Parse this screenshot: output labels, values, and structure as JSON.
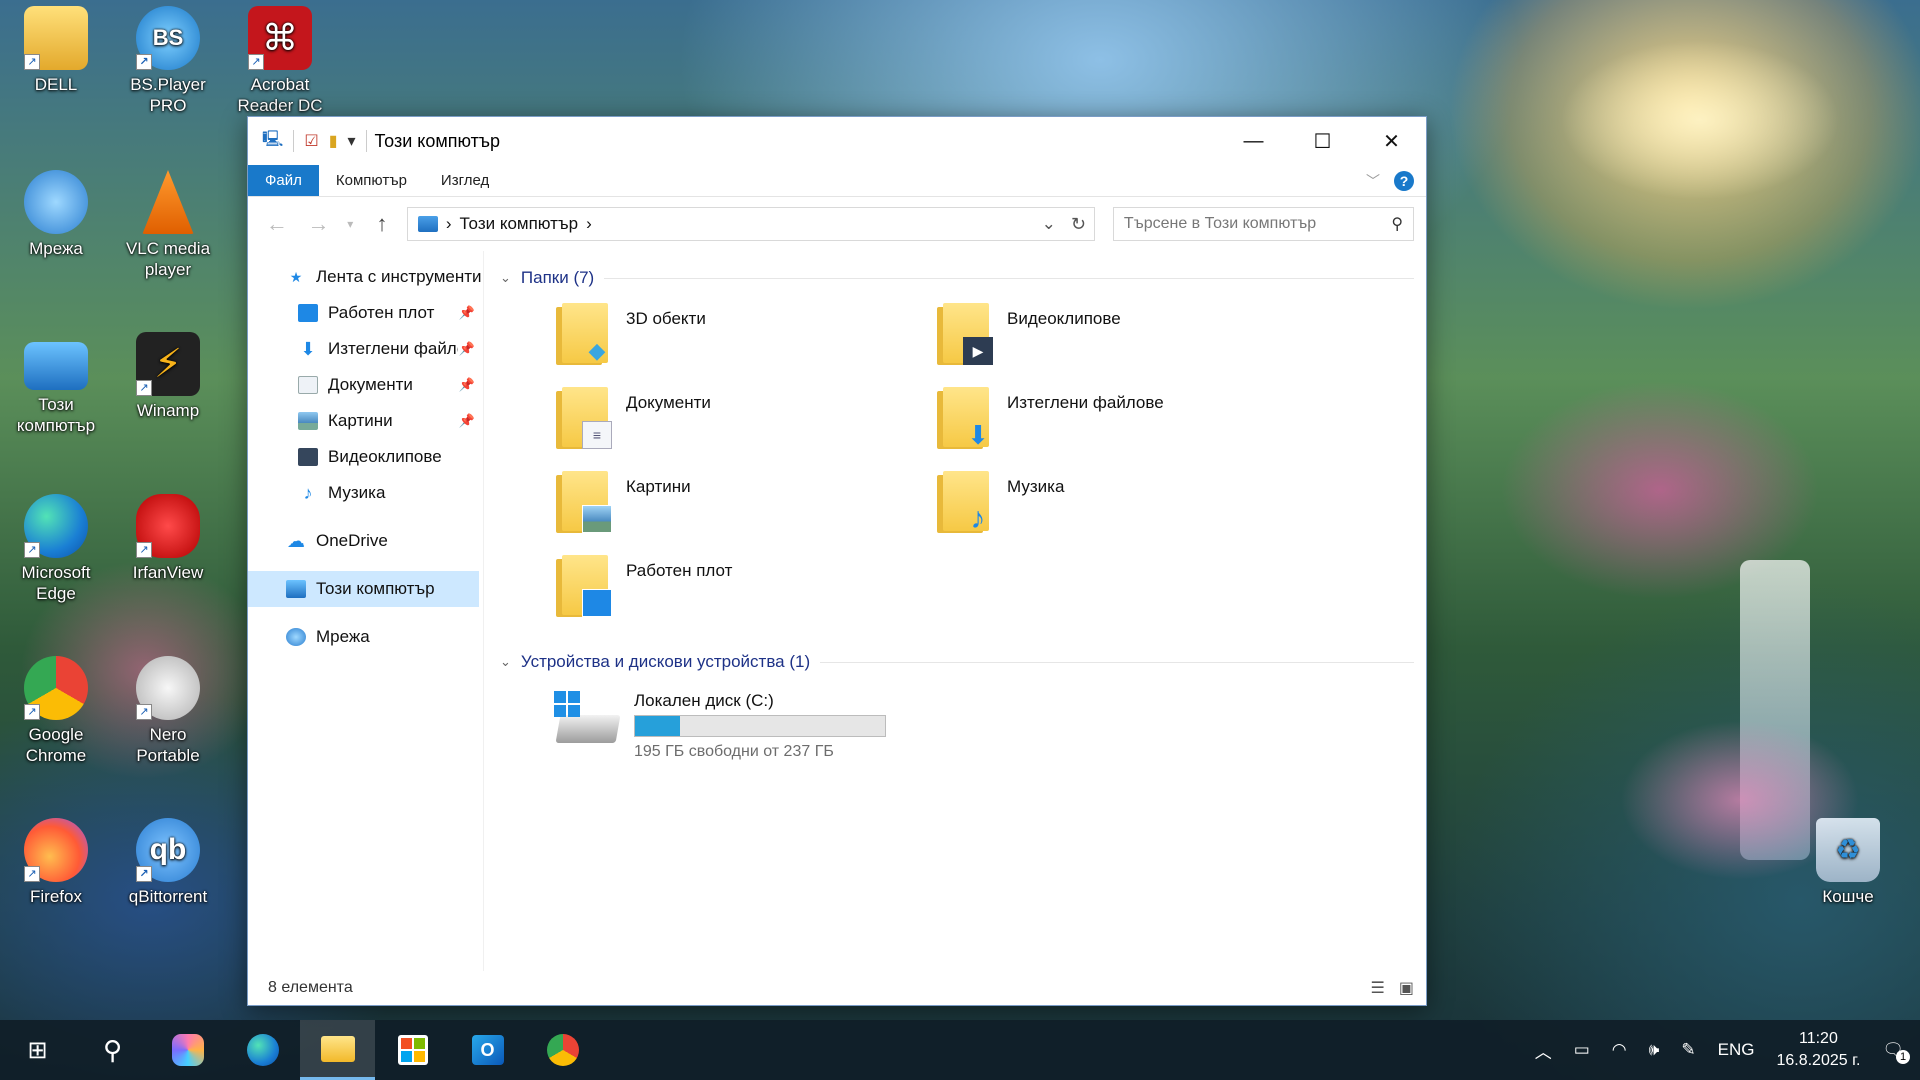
{
  "desktop": {
    "icons": [
      {
        "label": "DELL"
      },
      {
        "label": "BS.Player PRO"
      },
      {
        "label": "Acrobat Reader DC"
      },
      {
        "label": "Мрежа"
      },
      {
        "label": "VLC media player"
      },
      {
        "label": "Този компютър"
      },
      {
        "label": "Winamp"
      },
      {
        "label": "Microsoft Edge"
      },
      {
        "label": "IrfanView"
      },
      {
        "label": "Google Chrome"
      },
      {
        "label": "Nero Portable"
      },
      {
        "label": "Firefox"
      },
      {
        "label": "qBittorrent"
      },
      {
        "label": "Кошче"
      }
    ]
  },
  "window": {
    "title": "Този компютър",
    "ribbon": {
      "tabs": [
        "Файл",
        "Компютър",
        "Изглед"
      ],
      "help": "?"
    },
    "address": {
      "crumb": "Този компютър"
    },
    "search": {
      "placeholder": "Търсене в Този компютър"
    },
    "nav": {
      "quick_access": "Лента с инструменти",
      "items": [
        {
          "label": "Работен плот",
          "pinned": true
        },
        {
          "label": "Изтеглени файлове",
          "pinned": true
        },
        {
          "label": "Документи",
          "pinned": true
        },
        {
          "label": "Картини",
          "pinned": true
        },
        {
          "label": "Видеоклипове",
          "pinned": false
        },
        {
          "label": "Музика",
          "pinned": false
        }
      ],
      "onedrive": "OneDrive",
      "this_pc": "Този компютър",
      "network": "Мрежа"
    },
    "folders_header": "Папки (7)",
    "folders": [
      {
        "name": "3D обекти",
        "icon": "cube-icon"
      },
      {
        "name": "Видеоклипове",
        "icon": "film-icon"
      },
      {
        "name": "Документи",
        "icon": "document-icon"
      },
      {
        "name": "Изтеглени файлове",
        "icon": "download-arrow-icon"
      },
      {
        "name": "Картини",
        "icon": "picture-icon"
      },
      {
        "name": "Музика",
        "icon": "music-note-icon"
      },
      {
        "name": "Работен плот",
        "icon": "desktop-icon"
      }
    ],
    "devices_header": "Устройства и дискови устройства (1)",
    "drive": {
      "name": "Локален диск (C:)",
      "free_text": "195 ГБ свободни от 237 ГБ",
      "used_fraction": 0.18
    },
    "status": "8 елемента"
  },
  "taskbar": {
    "lang": "ENG",
    "time": "11:20",
    "date": "16.8.2025 г.",
    "notif_count": "1"
  },
  "colors": {
    "accent": "#1979ca",
    "selection": "#cde8ff",
    "drive_bar": "#26a0da",
    "folder": "#f6c945"
  }
}
